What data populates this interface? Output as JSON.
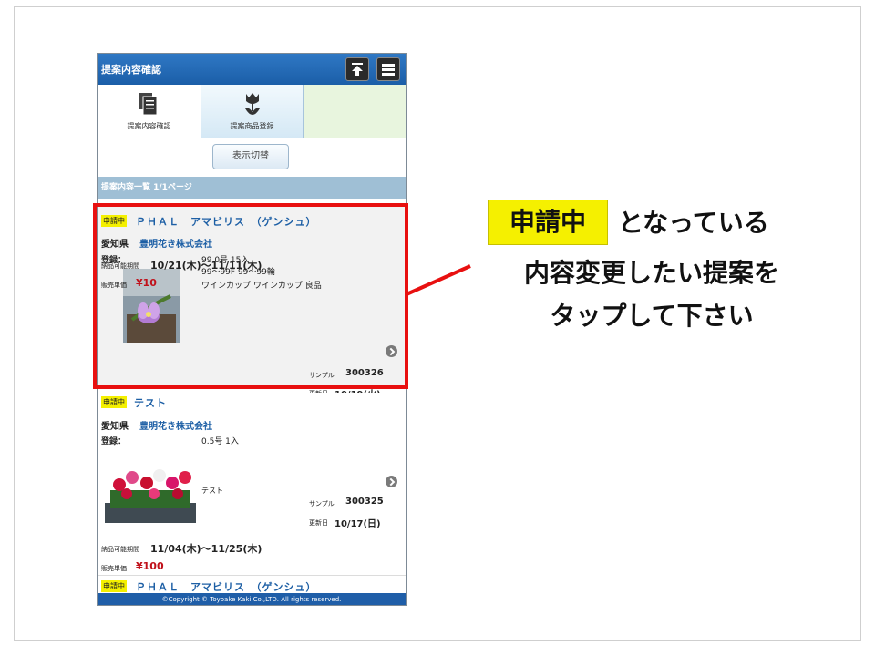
{
  "header": {
    "title": "提案内容確認",
    "up_icon": "arrow-up-icon",
    "menu_icon": "menu-icon"
  },
  "tabs": [
    {
      "label": "提案内容確認",
      "icon": "document-icon"
    },
    {
      "label": "提案商品登録",
      "icon": "tulip-icon"
    }
  ],
  "switch_button": "表示切替",
  "list_header": "提案内容一覧 1/1ページ",
  "items": [
    {
      "status": "申請中",
      "title": "ＰＨＡＬ　アマビリス　（ゲンシュ）",
      "prefecture": "愛知県",
      "company": "豊明花き株式会社",
      "reg_label": "登録：",
      "spec_lines": [
        "99.0号 15入",
        "99～99F 99～99輪",
        "ワインカップ ワインカップ 良品"
      ],
      "note": "",
      "sample_label": "サンプル",
      "sample_no": "300326",
      "updated_label": "更新日",
      "updated": "10/19(火)",
      "period_label": "納品可能期間",
      "period": "10/21(木)～11/11(木)",
      "price_label": "販売単価",
      "price": "¥10"
    },
    {
      "status": "申請中",
      "title": "テスト",
      "prefecture": "愛知県",
      "company": "豊明花き株式会社",
      "reg_label": "登録：",
      "spec_lines": [
        "0.5号 1入"
      ],
      "note": "テスト",
      "sample_label": "サンプル",
      "sample_no": "300325",
      "updated_label": "更新日",
      "updated": "10/17(日)",
      "period_label": "納品可能期間",
      "period": "11/04(木)～11/25(木)",
      "price_label": "販売単価",
      "price": "¥100"
    },
    {
      "status": "申請中",
      "title": "ＰＨＡＬ　アマビリス　（ゲンシュ）"
    }
  ],
  "footer": "©Copyright © Toyoake Kaki Co.,LTD. All rights reserved.",
  "callout": {
    "badge": "申請中",
    "line1_rest": "となっている",
    "line2": "内容変更したい提案を",
    "line3": "タップして下さい"
  },
  "colors": {
    "accent_blue": "#1d5fa5",
    "badge_yellow": "#f4f000",
    "highlight_red": "#e81010",
    "price_red": "#c0101a"
  }
}
